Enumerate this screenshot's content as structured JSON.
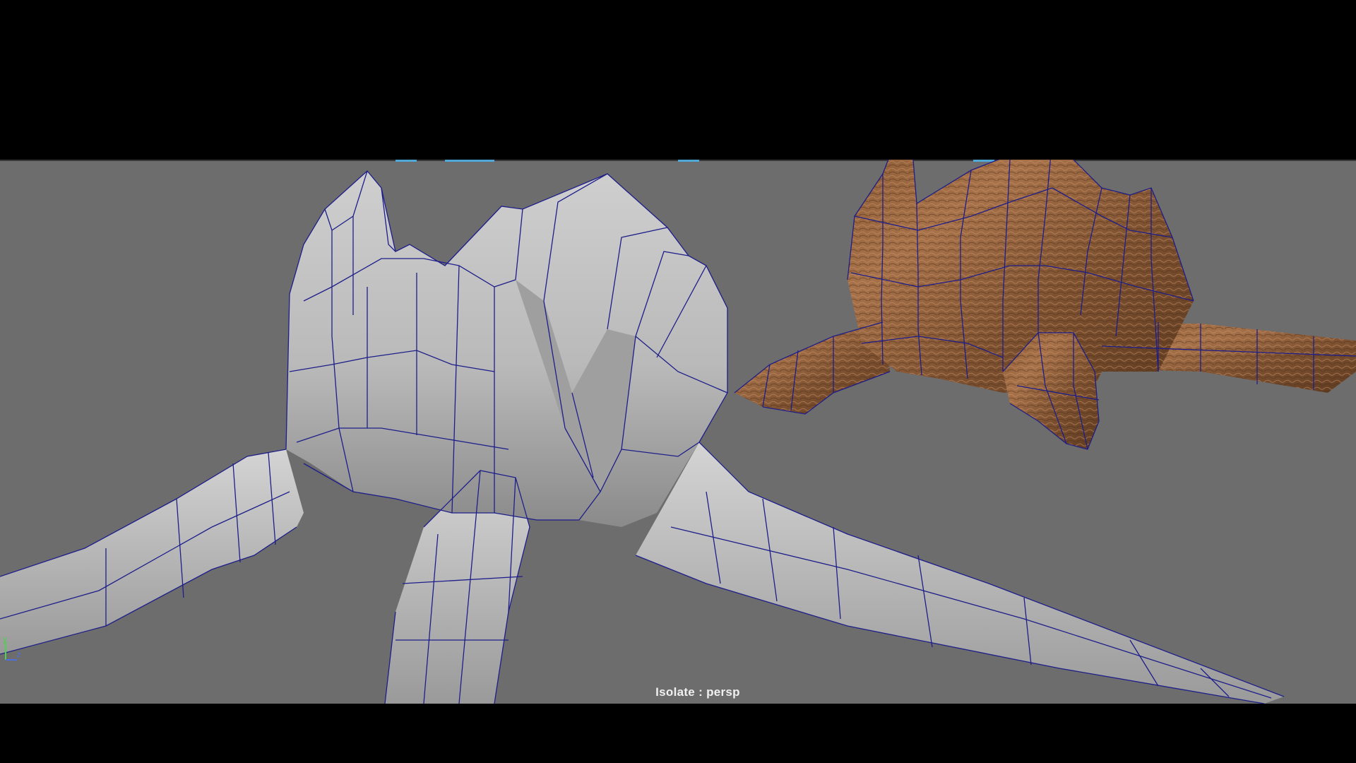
{
  "viewport": {
    "camera_label": "Isolate : persp",
    "background_color": "#6d6d6d",
    "wireframe_color": "#1e1e8a"
  },
  "axis_indicator": {
    "y_label": "y",
    "z_label": "z",
    "y_color": "#4fd04f",
    "z_color": "#4f6fe0"
  },
  "models": [
    {
      "name": "untextured-creature-mesh",
      "shading": "grey-smooth-wireframe"
    },
    {
      "name": "textured-creature-mesh",
      "shading": "bark-texture-wireframe"
    }
  ]
}
